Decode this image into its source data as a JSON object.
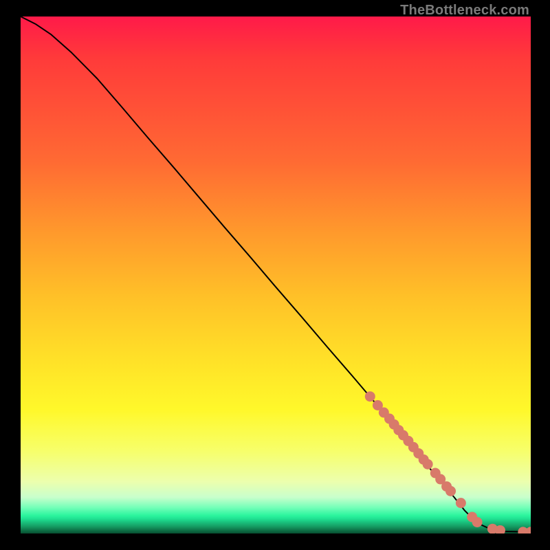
{
  "watermark": "TheBottleneck.com",
  "chart_data": {
    "type": "line",
    "title": "",
    "xlabel": "",
    "ylabel": "",
    "xlim": [
      0,
      100
    ],
    "ylim": [
      0,
      100
    ],
    "grid": false,
    "series": [
      {
        "name": "curve",
        "color": "#000000",
        "x": [
          0,
          3,
          6,
          10,
          15,
          20,
          25,
          30,
          35,
          40,
          45,
          50,
          55,
          60,
          65,
          70,
          74,
          78,
          82,
          85,
          87,
          88.5,
          90,
          92,
          95,
          100
        ],
        "y": [
          100,
          98.5,
          96.5,
          93,
          88,
          82.3,
          76.5,
          70.8,
          65,
          59.2,
          53.5,
          47.7,
          42,
          36.2,
          30.5,
          24.7,
          20,
          15.2,
          10.5,
          7,
          4.5,
          3,
          1.8,
          0.9,
          0.4,
          0.3
        ]
      },
      {
        "name": "dots",
        "color": "#d87a6a",
        "type": "scatter",
        "x": [
          68.5,
          70,
          71.2,
          72.3,
          73.2,
          74.1,
          75,
          76,
          77,
          78,
          79,
          79.8,
          81.3,
          82.3,
          83.5,
          84.3,
          86.3,
          88.5,
          89.5,
          92.5,
          94,
          98.5,
          100
        ],
        "y": [
          26.5,
          24.8,
          23.4,
          22.2,
          21.1,
          20,
          19,
          17.9,
          16.7,
          15.5,
          14.3,
          13.4,
          11.7,
          10.5,
          9.1,
          8.2,
          5.9,
          3.2,
          2.2,
          0.9,
          0.6,
          0.3,
          0.3
        ]
      }
    ],
    "background_gradient": {
      "direction": "vertical",
      "stops": [
        {
          "pos": 0.0,
          "color": "#ff1a49"
        },
        {
          "pos": 0.42,
          "color": "#ff9a2c"
        },
        {
          "pos": 0.76,
          "color": "#fff82a"
        },
        {
          "pos": 0.965,
          "color": "#2cf59e"
        },
        {
          "pos": 1.0,
          "color": "#084f31"
        }
      ]
    }
  }
}
